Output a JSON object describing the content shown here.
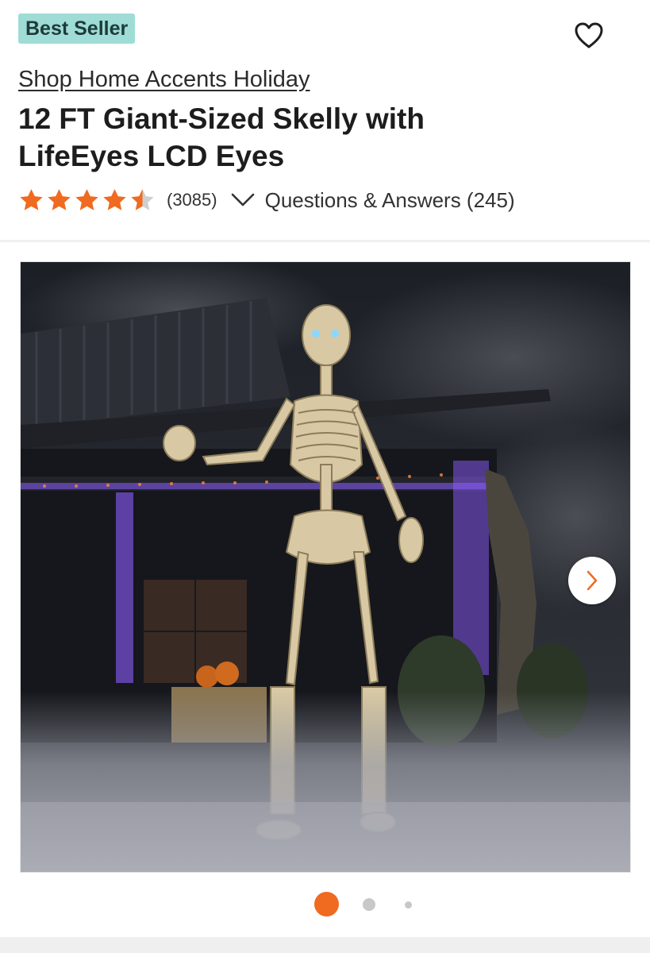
{
  "badge": {
    "label": "Best Seller"
  },
  "brand": {
    "link_text": "Shop Home Accents Holiday"
  },
  "product": {
    "title_line1": "12 FT Giant-Sized Skelly with",
    "title_line2": "LifeEyes LCD Eyes"
  },
  "rating": {
    "stars": 4.5,
    "review_count": "(3085)",
    "qa_link": "Questions & Answers (245)"
  },
  "gallery": {
    "current_index": 1,
    "total_dots": 3
  },
  "colors": {
    "accent": "#f06a1f",
    "badge_bg": "#9fdcd6",
    "star": "#f06a1f",
    "inactive_dot": "#c8c8c8"
  },
  "icons": {
    "favorite": "heart-outline-icon",
    "expand": "chevron-down-icon",
    "next": "chevron-right-icon"
  }
}
